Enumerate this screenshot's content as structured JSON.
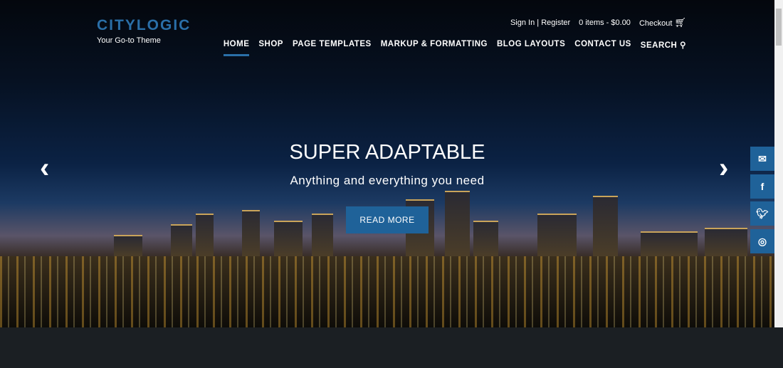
{
  "header": {
    "logo": "CITYLOGIC",
    "tagline": "Your Go-to Theme",
    "sign_in": "Sign In",
    "separator": "|",
    "register": "Register",
    "cart": "0 items - $0.00",
    "checkout": "Checkout",
    "nav": [
      "HOME",
      "SHOP",
      "PAGE TEMPLATES",
      "MARKUP & FORMATTING",
      "BLOG LAYOUTS",
      "CONTACT US",
      "SEARCH"
    ]
  },
  "slider": {
    "title": "SUPER ADAPTABLE",
    "subtitle": "Anything and everything you need",
    "button": "READ MORE",
    "prev": "‹",
    "next": "›"
  },
  "social": [
    "email-icon",
    "facebook-icon",
    "twitter-icon",
    "instagram-icon"
  ],
  "colors": {
    "accent": "#1f6299",
    "footer": "#1b1f23"
  }
}
